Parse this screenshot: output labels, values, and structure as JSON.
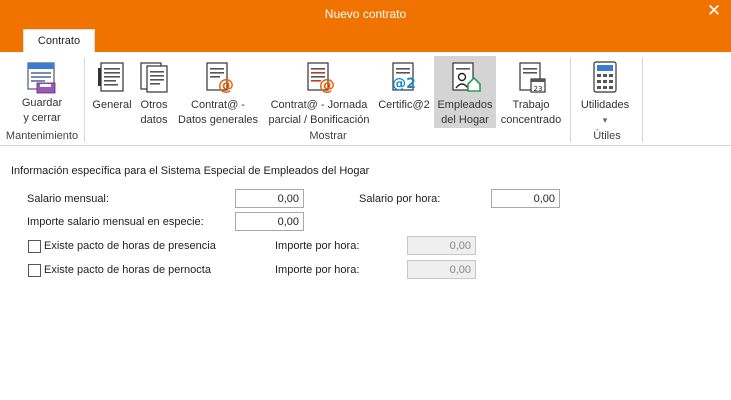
{
  "window": {
    "title": "Nuevo contrato",
    "close_glyph": "✕"
  },
  "tabs": [
    {
      "label": "Contrato"
    }
  ],
  "ribbon": {
    "guardar": {
      "line1": "Guardar",
      "line2": "y cerrar",
      "icon": "save-icon"
    },
    "general": {
      "line1": "General",
      "icon": "document-icon"
    },
    "otros": {
      "line1": "Otros",
      "line2": "datos",
      "icon": "documents-icon"
    },
    "contrata_datos": {
      "line1": "Contrat@ -",
      "line2": "Datos generales",
      "icon": "contrata-icon"
    },
    "contrata_jornada": {
      "line1": "Contrat@ - Jornada",
      "line2": "parcial / Bonificación",
      "icon": "contrata-jornada-icon"
    },
    "certifica": {
      "line1": "Certific@2",
      "icon": "certifica-icon"
    },
    "empleados": {
      "line1": "Empleados",
      "line2": "del Hogar",
      "icon": "home-user-icon"
    },
    "trabajo": {
      "line1": "Trabajo",
      "line2": "concentrado",
      "icon": "calendar-icon"
    },
    "utilidades": {
      "line1": "Utilidades",
      "line2": "▾",
      "icon": "calculator-icon"
    },
    "groups": {
      "mantenimiento": "Mantenimiento",
      "mostrar": "Mostrar",
      "utiles": "Útiles"
    }
  },
  "form": {
    "section_title": "Información específica para el Sistema Especial de Empleados del Hogar",
    "salario_mensual": {
      "label": "Salario mensual:",
      "value": "0,00"
    },
    "salario_hora": {
      "label": "Salario por hora:",
      "value": "0,00"
    },
    "importe_especie": {
      "label": "Importe salario mensual en especie:",
      "value": "0,00"
    },
    "pacto_presencia": {
      "label": "Existe pacto de horas de presencia",
      "checked": false,
      "importe_label": "Importe por hora:",
      "importe_value": "0,00"
    },
    "pacto_pernocta": {
      "label": "Existe pacto de horas de pernocta",
      "checked": false,
      "importe_label": "Importe por hora:",
      "importe_value": "0,00"
    }
  },
  "colors": {
    "accent": "#f07300",
    "active_button": "#d4d4d4"
  }
}
